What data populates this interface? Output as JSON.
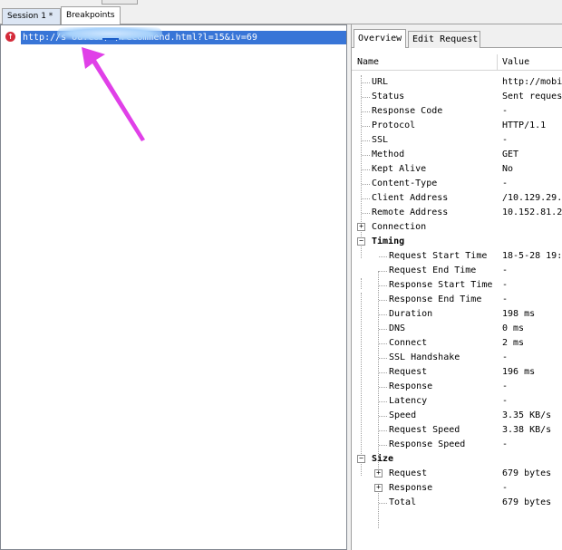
{
  "tabs": {
    "session": "Session 1 *",
    "breakpoints": "Breakpoints"
  },
  "session_list": {
    "url": "http://s                    ou.com/m/recommend.html?l=15&iv=69"
  },
  "inspector": {
    "tabs": [
      "Overview",
      "Edit Request"
    ],
    "columns": {
      "name": "Name",
      "value": "Value"
    },
    "rows": [
      {
        "name": "URL",
        "value": "http://mobi"
      },
      {
        "name": "Status",
        "value": "Sent reques"
      },
      {
        "name": "Response Code",
        "value": "-"
      },
      {
        "name": "Protocol",
        "value": "HTTP/1.1"
      },
      {
        "name": "SSL",
        "value": "-"
      },
      {
        "name": "Method",
        "value": "GET"
      },
      {
        "name": "Kept Alive",
        "value": "No"
      },
      {
        "name": "Content-Type",
        "value": "-"
      },
      {
        "name": "Client Address",
        "value": "/10.129.29."
      },
      {
        "name": "Remote Address",
        "value": "10.152.81.2"
      },
      {
        "name": "Connection",
        "value": ""
      },
      {
        "name": "Timing",
        "value": ""
      },
      {
        "name": "Request Start Time",
        "value": "18-5-28 19:"
      },
      {
        "name": "Request End Time",
        "value": "-"
      },
      {
        "name": "Response Start Time",
        "value": "-"
      },
      {
        "name": "Response End Time",
        "value": "-"
      },
      {
        "name": "Duration",
        "value": "198 ms"
      },
      {
        "name": "DNS",
        "value": "0 ms"
      },
      {
        "name": "Connect",
        "value": "2 ms"
      },
      {
        "name": "SSL Handshake",
        "value": "-"
      },
      {
        "name": "Request",
        "value": "196 ms"
      },
      {
        "name": "Response",
        "value": "-"
      },
      {
        "name": "Latency",
        "value": "-"
      },
      {
        "name": "Speed",
        "value": "3.35 KB/s"
      },
      {
        "name": "Request Speed",
        "value": "3.38 KB/s"
      },
      {
        "name": "Response Speed",
        "value": "-"
      },
      {
        "name": "Size",
        "value": ""
      },
      {
        "name": "Request",
        "value": "679 bytes"
      },
      {
        "name": "Response",
        "value": "-"
      },
      {
        "name": "Total",
        "value": "679 bytes"
      }
    ]
  },
  "colors": {
    "selection": "#3875d7",
    "arrow": "#e040e8",
    "breakpoint_icon": "#d42b3a"
  }
}
